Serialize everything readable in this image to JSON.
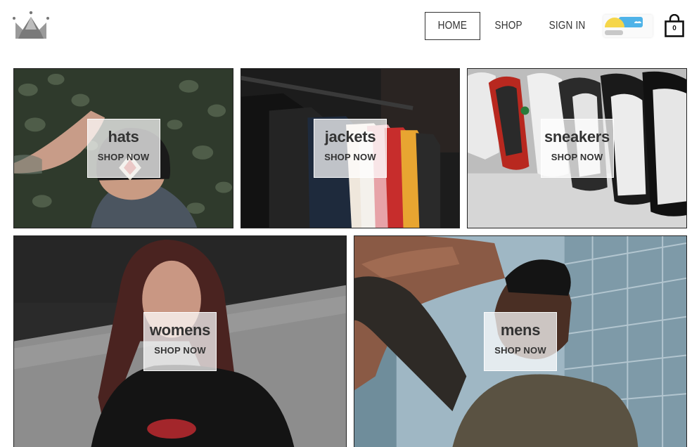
{
  "brand": {
    "logo_icon": "crown-icon"
  },
  "nav": {
    "items": [
      {
        "label": "HOME",
        "active": true
      },
      {
        "label": "SHOP",
        "active": false
      },
      {
        "label": "SIGN IN",
        "active": false
      }
    ],
    "weather_icon": "sun-cloud-icon",
    "cart": {
      "icon": "shopping-bag-icon",
      "count": "0"
    }
  },
  "categories": [
    {
      "title": "hats",
      "cta": "SHOP NOW"
    },
    {
      "title": "jackets",
      "cta": "SHOP NOW"
    },
    {
      "title": "sneakers",
      "cta": "SHOP NOW"
    },
    {
      "title": "womens",
      "cta": "SHOP NOW"
    },
    {
      "title": "mens",
      "cta": "SHOP NOW"
    }
  ],
  "colors": {
    "text": "#333333",
    "border": "#222222",
    "overlay": "#ffffff"
  }
}
